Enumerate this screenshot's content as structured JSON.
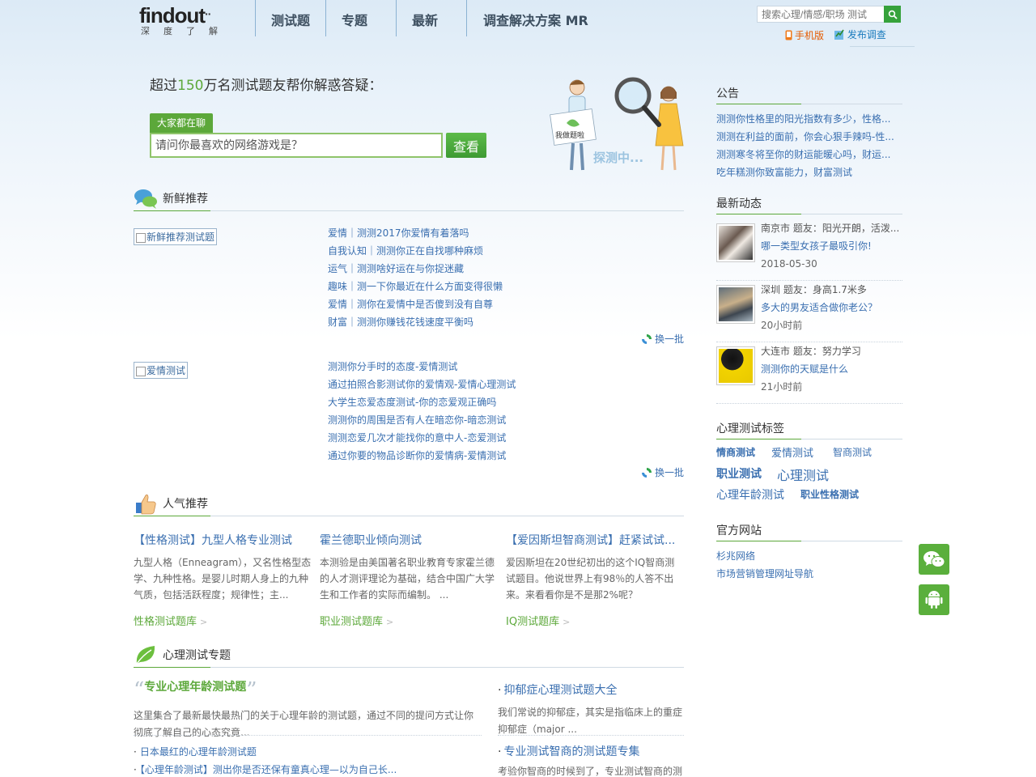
{
  "header": {
    "logo_text": "findout",
    "logo_tagline": "深度了解",
    "nav": [
      "测试题",
      "专题",
      "最新",
      "调查解决方案 MR"
    ],
    "search_placeholder": "搜索心理/情感/职场 测试",
    "mobile_link": "手机版",
    "survey_link": "发布调查"
  },
  "hero": {
    "title_prefix": "超过",
    "title_number": "150",
    "title_suffix": "万名测试题友帮你解惑答疑：",
    "tab_label": "大家都在聊",
    "question": "请问你最喜欢的网络游戏是？",
    "button": "查看",
    "illustration_text_1": "我做题啦",
    "illustration_text_2": "探测中..."
  },
  "fresh": {
    "title": "新鲜推荐",
    "groups": [
      {
        "image_alt": "新鲜推荐测试题",
        "items": [
          "爱情｜测测2017你爱情有着落吗",
          "自我认知｜测测你正在自找哪种麻烦",
          "运气｜测测啥好运在与你捉迷藏",
          "趣味｜测一下你最近在什么方面变得很懒",
          "爱情｜测你在爱情中是否傻到没有自尊",
          "财富｜测测你赚钱花钱速度平衡吗"
        ],
        "refresh": "换一批"
      },
      {
        "image_alt": "爱情测试",
        "items": [
          "测测你分手时的态度-爱情测试",
          "通过拍照合影测试你的爱情观-爱情心理测试",
          "大学生恋爱态度测试-你的恋爱观正确吗",
          "测测你的周围是否有人在暗恋你-暗恋测试",
          "测测恋爱几次才能找你的意中人-恋爱测试",
          "通过你要的物品诊断你的爱情病-爱情测试"
        ],
        "refresh": "换一批"
      }
    ]
  },
  "popular": {
    "title": "人气推荐",
    "cols": [
      {
        "title": "【性格测试】九型人格专业测试",
        "desc": "九型人格（Enneagram），又名性格型态学、九种性格。是婴儿时期人身上的九种气质，包括活跃程度；规律性；主...",
        "lib": "性格测试题库"
      },
      {
        "title": "霍兰德职业倾向测试",
        "desc": "本测验是由美国著名职业教育专家霍兰德的人才测评理论为基础，结合中国广大学生和工作者的实际而编制。 ...",
        "lib": "职业测试题库"
      },
      {
        "title": "【爱因斯坦智商测试】赶紧试试...",
        "desc": "爱因斯坦在20世纪初出的这个IQ智商测试题目。他说世界上有98％的人答不出来。来看看你是不是那2%呢？",
        "lib": "IQ测试题库"
      }
    ]
  },
  "topic": {
    "title": "心理测试专题",
    "featured": {
      "title": "专业心理年龄测试题",
      "desc": "这里集合了最新最快最热门的关于心理年龄的测试题，通过不同的提问方式让你彻底了解自己的心态究竟..."
    },
    "list": [
      "日本最红的心理年龄测试题",
      "【心理年龄测试】测出你是否还保有童真心理—以为自己长..."
    ],
    "right": [
      {
        "title": "抑郁症心理测试题大全",
        "desc": "我们常说的抑郁症，其实是指临床上的重症抑郁症（major ..."
      },
      {
        "title": "专业测试智商的测试题专集",
        "desc": "考验你智商的时候到了，专业测试智商的测"
      }
    ]
  },
  "sidebar": {
    "notice_title": "公告",
    "notices": [
      "测测你性格里的阳光指数有多少，性格...",
      "测测在利益的面前，你会心狠手辣吗-性...",
      "测测寒冬将至你的财运能暖心吗，财运...",
      "吃年糕测你致富能力，财富测试"
    ],
    "feed_title": "最新动态",
    "feed": [
      {
        "who": "南京市 题友：阳光开朗，活泼...",
        "what": "哪一类型女孩子最吸引你!",
        "when": "2018-05-30"
      },
      {
        "who": "深圳 题友：身高1.7米多",
        "what": "多大的男友适合做你老公？",
        "when": "20小时前"
      },
      {
        "who": "大连市 题友：努力学习",
        "what": "测测你的天赋是什么",
        "when": "21小时前"
      }
    ],
    "tags_title": "心理测试标签",
    "tags": [
      "情商测试",
      "爱情测试",
      "智商测试",
      "职业测试",
      "心理测试",
      "心理年龄测试",
      "职业性格测试"
    ],
    "links_title": "官方网站",
    "links": [
      "杉兆网络",
      "市场营销管理网址导航"
    ]
  },
  "colors": {
    "accent_green": "#5ca83a",
    "link_blue": "#3a6fb0",
    "nav_text": "#3d4f60"
  }
}
